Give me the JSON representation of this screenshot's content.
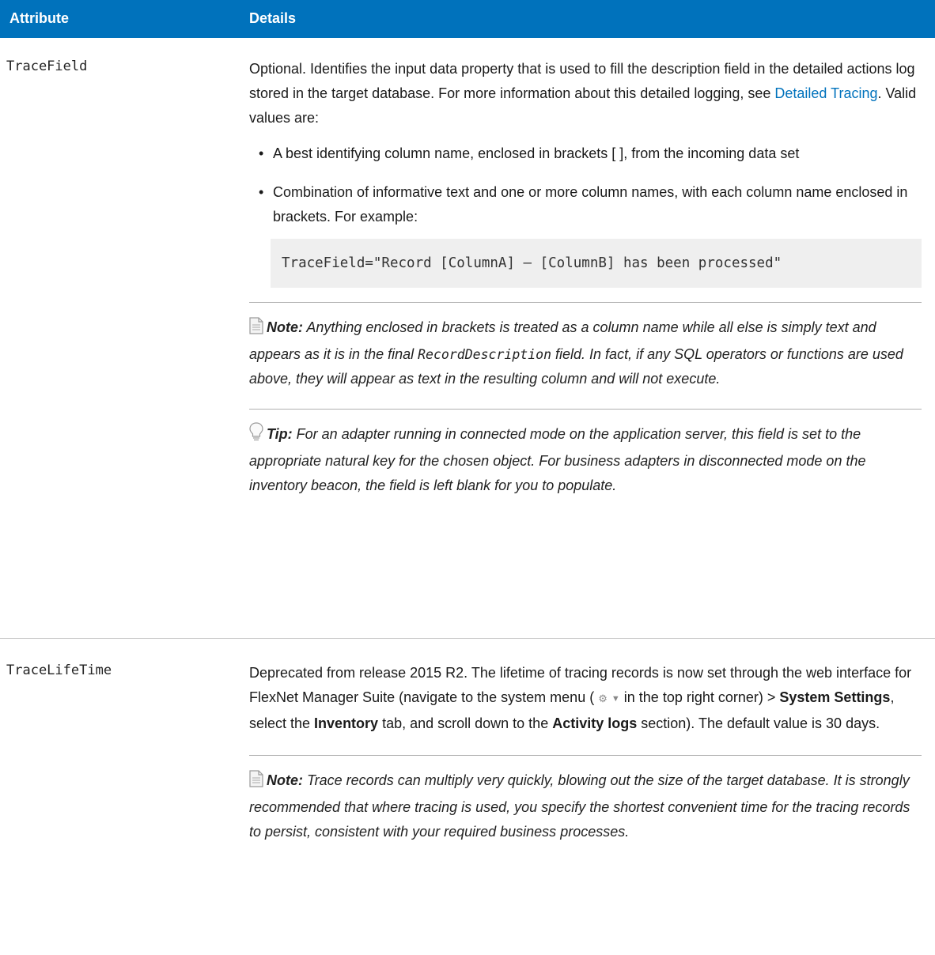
{
  "table": {
    "header_attribute": "Attribute",
    "header_details": "Details"
  },
  "rows": [
    {
      "attribute": "TraceField",
      "intro_1": "Optional. Identifies the input data property that is used to fill the description field in the detailed actions log stored in the target database. For more information about this detailed logging, see ",
      "link": "Detailed Tracing",
      "intro_2": ". Valid values are:",
      "bullet_1": "A best identifying column name, enclosed in brackets [ ], from the incoming data set",
      "bullet_2": "Combination of informative text and one or more column names, with each column name enclosed in brackets. For example:",
      "code": "TraceField=\"Record [ColumnA] – [ColumnB] has been processed\"",
      "note_label": "Note:",
      "note_text_1": " Anything enclosed in brackets is treated as a column name while all else is simply text and appears as it is in the final ",
      "note_code": "RecordDescription",
      "note_text_2": " field. In fact, if any SQL operators or functions are used above, they will appear as text in the resulting column and will not execute.",
      "tip_label": "Tip:",
      "tip_text": " For an adapter running in connected mode on the application server, this field is set to the appropriate natural key for the chosen object. For business adapters in disconnected mode on the inventory beacon, the field is left blank for you to populate."
    },
    {
      "attribute": "TraceLifeTime",
      "text_1": "Deprecated from release 2015 R2. The lifetime of tracing records is now set through the web interface for FlexNet Manager Suite (navigate to the system menu (",
      "text_2": " in the top right corner) > ",
      "bold_1": "System Settings",
      "text_3": ", select the ",
      "bold_2": "Inventory",
      "text_4": " tab, and scroll down to the ",
      "bold_3": "Activity logs",
      "text_5": " section). The default value is 30 days.",
      "note_label": "Note:",
      "note_text": " Trace records can multiply very quickly, blowing out the size of the target database. It is strongly recommended that where tracing is used, you specify the shortest convenient time for the tracing records to persist, consistent with your required business processes."
    }
  ],
  "icons": {
    "note": "note-icon",
    "tip": "lightbulb-icon",
    "system_menu": "gear-icon",
    "dropdown": "triangle-down-icon"
  },
  "colors": {
    "header_bg": "#0072bc",
    "link": "#0072bc",
    "code_bg": "#efefef"
  }
}
